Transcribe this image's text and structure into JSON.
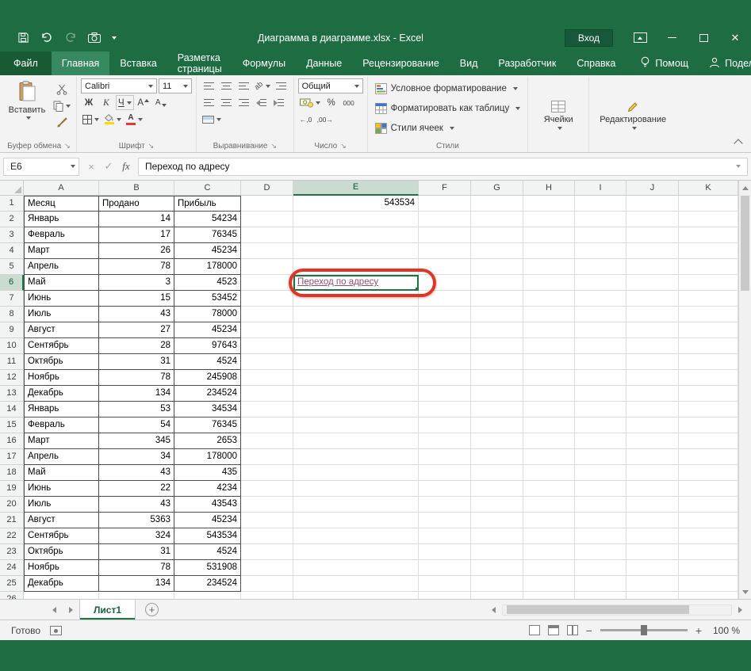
{
  "titlebar": {
    "title": "Диаграмма в диаграмме.xlsx - Excel",
    "sign_in": "Вход"
  },
  "ribbon_tabs": {
    "file": "Файл",
    "active": "Главная",
    "tabs": [
      "Главная",
      "Вставка",
      "Разметка страницы",
      "Формулы",
      "Данные",
      "Рецензирование",
      "Вид",
      "Разработчик",
      "Справка"
    ],
    "help": "Помощ",
    "share": "Поделиться"
  },
  "ribbon": {
    "clipboard": {
      "label": "Буфер обмена",
      "paste": "Вставить"
    },
    "font": {
      "label": "Шрифт",
      "name": "Calibri",
      "size": "11",
      "bold": "Ж",
      "italic": "К",
      "underline": "Ч",
      "letter": "А"
    },
    "alignment": {
      "label": "Выравнивание",
      "orientation": "ab"
    },
    "number": {
      "label": "Число",
      "format": "Общий",
      "percent": "%",
      "thousand": "000",
      "dec_inc": "←,0",
      "dec_dec": ",00→"
    },
    "styles": {
      "label": "Стили",
      "conditional": "Условное форматирование",
      "as_table": "Форматировать как таблицу",
      "cell_styles": "Стили ячеек"
    },
    "cells": {
      "label": "Ячейки"
    },
    "editing": {
      "label": "Редактирование"
    }
  },
  "formula_bar": {
    "name_box": "E6",
    "cancel": "×",
    "enter": "✓",
    "fx": "fx",
    "value": "Переход по адресу"
  },
  "grid": {
    "columns": [
      "A",
      "B",
      "C",
      "D",
      "E",
      "F",
      "G",
      "H",
      "I",
      "J",
      "K"
    ],
    "selected_column": "E",
    "selected_row": 6,
    "rows": [
      {
        "n": 1,
        "A": "Месяц",
        "B": "Продано",
        "C": "Прибыль",
        "E": "543534"
      },
      {
        "n": 2,
        "A": "Январь",
        "B": "14",
        "C": "54234"
      },
      {
        "n": 3,
        "A": "Февраль",
        "B": "17",
        "C": "76345"
      },
      {
        "n": 4,
        "A": "Март",
        "B": "26",
        "C": "45234"
      },
      {
        "n": 5,
        "A": "Апрель",
        "B": "78",
        "C": "178000"
      },
      {
        "n": 6,
        "A": "Май",
        "B": "3",
        "C": "4523",
        "E": "Переход по адресу"
      },
      {
        "n": 7,
        "A": "Июнь",
        "B": "15",
        "C": "53452"
      },
      {
        "n": 8,
        "A": "Июль",
        "B": "43",
        "C": "78000"
      },
      {
        "n": 9,
        "A": "Август",
        "B": "27",
        "C": "45234"
      },
      {
        "n": 10,
        "A": "Сентябрь",
        "B": "28",
        "C": "97643"
      },
      {
        "n": 11,
        "A": "Октябрь",
        "B": "31",
        "C": "4524"
      },
      {
        "n": 12,
        "A": "Ноябрь",
        "B": "78",
        "C": "245908"
      },
      {
        "n": 13,
        "A": "Декабрь",
        "B": "134",
        "C": "234524"
      },
      {
        "n": 14,
        "A": "Январь",
        "B": "53",
        "C": "34534"
      },
      {
        "n": 15,
        "A": "Февраль",
        "B": "54",
        "C": "76345"
      },
      {
        "n": 16,
        "A": "Март",
        "B": "345",
        "C": "2653"
      },
      {
        "n": 17,
        "A": "Апрель",
        "B": "34",
        "C": "178000"
      },
      {
        "n": 18,
        "A": "Май",
        "B": "43",
        "C": "435"
      },
      {
        "n": 19,
        "A": "Июнь",
        "B": "22",
        "C": "4234"
      },
      {
        "n": 20,
        "A": "Июль",
        "B": "43",
        "C": "43543"
      },
      {
        "n": 21,
        "A": "Август",
        "B": "5363",
        "C": "45234"
      },
      {
        "n": 22,
        "A": "Сентябрь",
        "B": "324",
        "C": "543534"
      },
      {
        "n": 23,
        "A": "Октябрь",
        "B": "31",
        "C": "4524"
      },
      {
        "n": 24,
        "A": "Ноябрь",
        "B": "78",
        "C": "531908"
      },
      {
        "n": 25,
        "A": "Декабрь",
        "B": "134",
        "C": "234524"
      },
      {
        "n": 26
      }
    ]
  },
  "sheet_tabs": {
    "active": "Лист1",
    "add": "+"
  },
  "status_bar": {
    "mode": "Готово",
    "zoom_out": "−",
    "zoom_in": "+",
    "zoom": "100 %"
  }
}
